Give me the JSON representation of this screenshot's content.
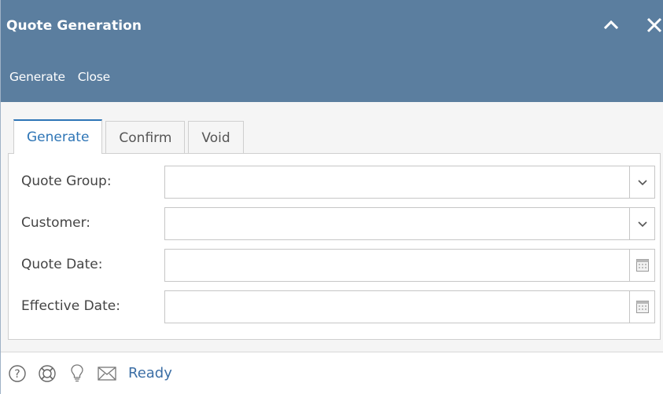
{
  "window": {
    "title": "Quote Generation",
    "collapse_icon": "chevron-up-icon",
    "close_icon": "close-icon"
  },
  "toolbar": {
    "generate_label": "Generate",
    "close_label": "Close"
  },
  "tabs": [
    {
      "label": "Generate",
      "active": true
    },
    {
      "label": "Confirm",
      "active": false
    },
    {
      "label": "Void",
      "active": false
    }
  ],
  "form": {
    "quote_group": {
      "label": "Quote Group:",
      "value": "",
      "control": "dropdown"
    },
    "customer": {
      "label": "Customer:",
      "value": "",
      "control": "dropdown"
    },
    "quote_date": {
      "label": "Quote Date:",
      "value": "",
      "control": "date"
    },
    "effective_date": {
      "label": "Effective Date:",
      "value": "",
      "control": "date"
    }
  },
  "statusbar": {
    "icons": [
      "help-icon",
      "support-icon",
      "lightbulb-icon",
      "mail-icon"
    ],
    "status": "Ready"
  },
  "colors": {
    "header_bg": "#5b7e9f",
    "accent": "#2e75b6",
    "status_text": "#3b6ea5"
  }
}
